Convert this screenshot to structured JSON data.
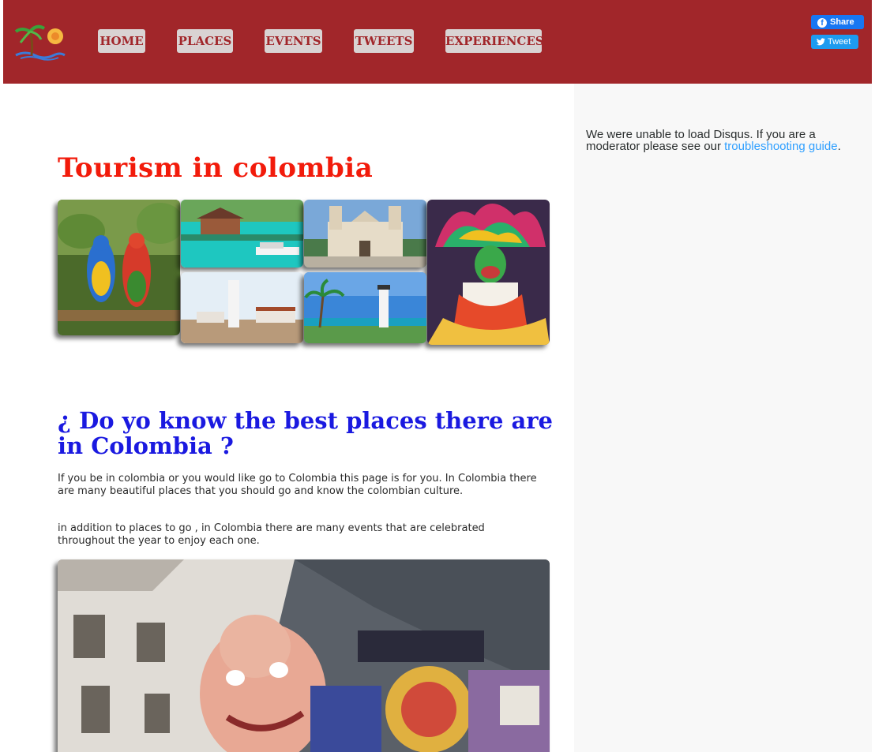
{
  "nav": {
    "items": [
      {
        "label": "HOME"
      },
      {
        "label": "PLACES"
      },
      {
        "label": "EVENTS"
      },
      {
        "label": "TWEETS"
      },
      {
        "label": "EXPERIENCES"
      }
    ]
  },
  "social": {
    "share_label": "Share",
    "tweet_label": "Tweet"
  },
  "main": {
    "title": "Tourism in colombia",
    "question": "¿ Do yo know the best places there are in Colombia ?",
    "paragraph1": "If you be in colombia or you would like go to Colombia this page is for you. In Colombia there are many beautiful places that you should go and know the colombian culture.",
    "paragraph2": "in addition to places to go , in Colombia there are many events that are celebrated throughout the year to enjoy each one."
  },
  "disqus": {
    "message_prefix": "We were unable to load Disqus. If you are a moderator please see our ",
    "link_text": "troubleshooting guide",
    "message_suffix": "."
  },
  "colors": {
    "header_bg": "#a1262a",
    "nav_button_bg": "#d9d3d3",
    "title_red": "#f21b0b",
    "title_blue": "#1a19e0",
    "link_blue": "#2e9fff"
  }
}
